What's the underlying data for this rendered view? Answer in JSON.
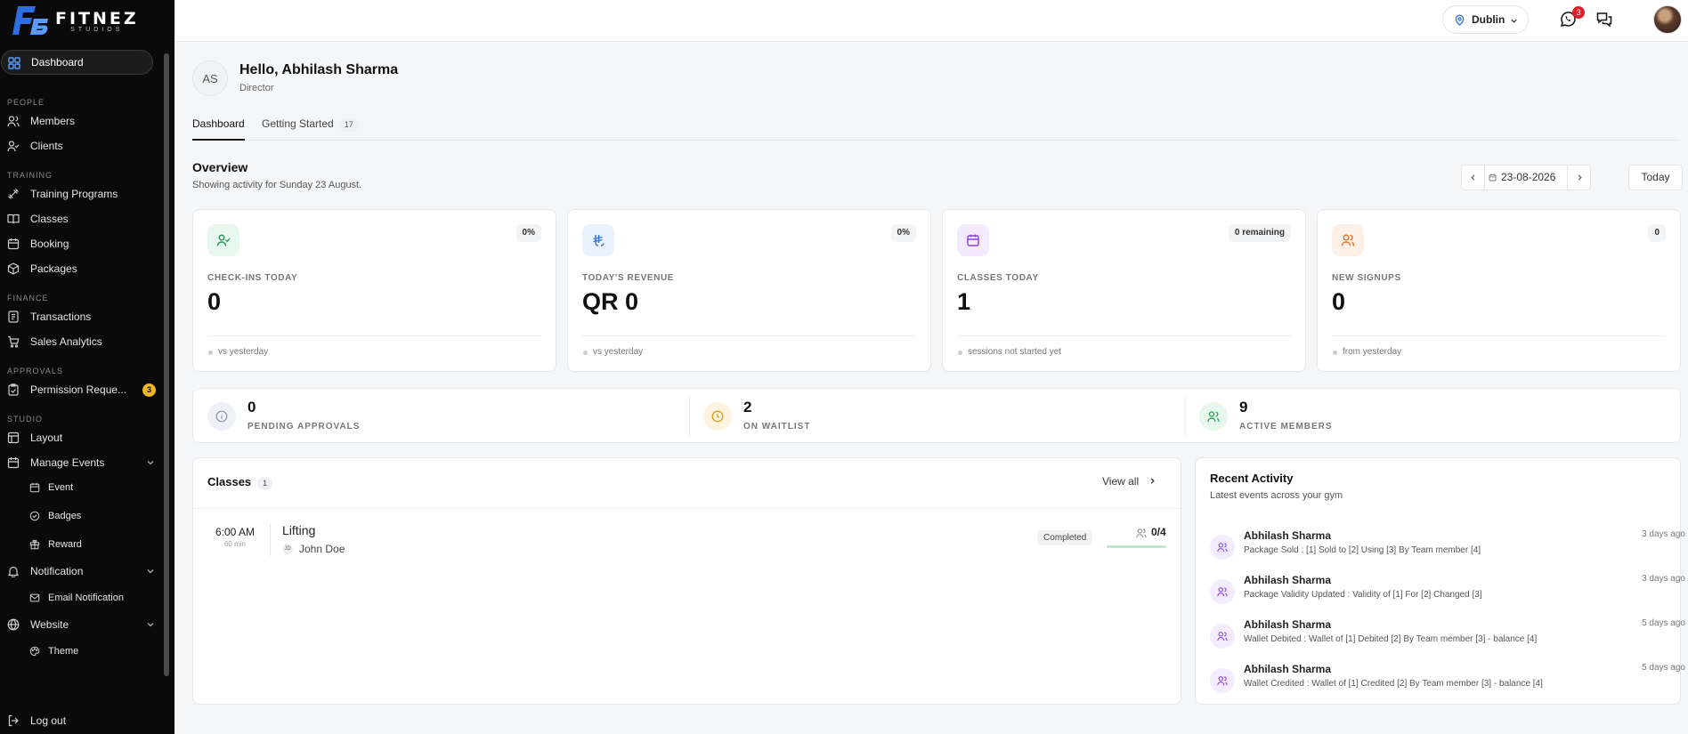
{
  "brand": {
    "name": "FITNEZ",
    "tagline": "STUDIOS"
  },
  "sidebar": {
    "dashboard": "Dashboard",
    "sections": {
      "people": "PEOPLE",
      "training": "TRAINING",
      "finance": "FINANCE",
      "approvals": "APPROVALS",
      "studio": "STUDIO"
    },
    "items": {
      "members": "Members",
      "clients": "Clients",
      "training_programs": "Training Programs",
      "classes": "Classes",
      "booking": "Booking",
      "packages": "Packages",
      "transactions": "Transactions",
      "sales_analytics": "Sales Analytics",
      "permission_requests": "Permission Reque...",
      "permission_badge": "3",
      "layout": "Layout",
      "manage_events": "Manage Events",
      "event": "Event",
      "badges": "Badges",
      "reward": "Reward",
      "notification": "Notification",
      "email_notification": "Email Notification",
      "website": "Website",
      "theme": "Theme"
    },
    "logout": "Log out"
  },
  "topbar": {
    "location": "Dublin",
    "whatsapp_badge": "3"
  },
  "user": {
    "initials": "AS",
    "greeting": "Hello, Abhilash Sharma",
    "role": "Director"
  },
  "tabs": {
    "dashboard": "Dashboard",
    "getting_started": "Getting Started",
    "getting_started_count": "17"
  },
  "overview": {
    "title": "Overview",
    "subtitle": "Showing activity for Sunday 23 August.",
    "date": "23-08-2026",
    "today_label": "Today"
  },
  "stats": [
    {
      "label": "CHECK-INS TODAY",
      "value": "0",
      "badge": "0%",
      "foot": "vs yesterday",
      "icon_color": "#1f9d55",
      "icon_bg": "#e8f8ee"
    },
    {
      "label": "TODAY'S REVENUE",
      "value": "QR 0",
      "badge": "0%",
      "foot": "vs yesterday",
      "icon_color": "#2f6fd6",
      "icon_bg": "#e9f1fc"
    },
    {
      "label": "CLASSES TODAY",
      "value": "1",
      "badge": "0 remaining",
      "foot": "sessions not started yet",
      "icon_color": "#8b3ee0",
      "icon_bg": "#f3ebfd"
    },
    {
      "label": "NEW SIGNUPS",
      "value": "0",
      "badge": "0",
      "foot": "from yesterday",
      "icon_color": "#e5742a",
      "icon_bg": "#fdf0e6"
    }
  ],
  "summary": [
    {
      "value": "0",
      "label": "PENDING APPROVALS",
      "icon_color": "#8a94a6",
      "icon_bg": "#eef1f6"
    },
    {
      "value": "2",
      "label": "ON WAITLIST",
      "icon_color": "#e09a1a",
      "icon_bg": "#fdf3e0"
    },
    {
      "value": "9",
      "label": "ACTIVE MEMBERS",
      "icon_color": "#1f9d55",
      "icon_bg": "#e6f7ec"
    }
  ],
  "classes": {
    "title": "Classes",
    "count": "1",
    "view_all": "View all",
    "items": [
      {
        "time": "6:00 AM",
        "duration": "60 min",
        "name": "Lifting",
        "trainer_initials": "JD",
        "trainer": "John Doe",
        "status": "Completed",
        "capacity": "0/4",
        "fill": 0.0
      }
    ]
  },
  "activity": {
    "title": "Recent Activity",
    "subtitle": "Latest events across your gym",
    "items": [
      {
        "name": "Abhilash Sharma",
        "desc": "Package Sold : [1] Sold to [2] Using [3] By Team member [4]",
        "time": "3 days ago"
      },
      {
        "name": "Abhilash Sharma",
        "desc": "Package Validity Updated : Validity of [1] For [2] Changed [3]",
        "time": "3 days ago"
      },
      {
        "name": "Abhilash Sharma",
        "desc": "Wallet Debited : Wallet of [1] Debited [2] By Team member [3] - balance [4]",
        "time": "5 days ago"
      },
      {
        "name": "Abhilash Sharma",
        "desc": "Wallet Credited : Wallet of [1] Credited [2] By Team member [3] - balance [4]",
        "time": "5 days ago"
      }
    ]
  },
  "colors": {
    "sidebar_bg": "#0a0a0a",
    "permission_badge": "#f0b429",
    "notification_badge": "#e11d2e"
  }
}
